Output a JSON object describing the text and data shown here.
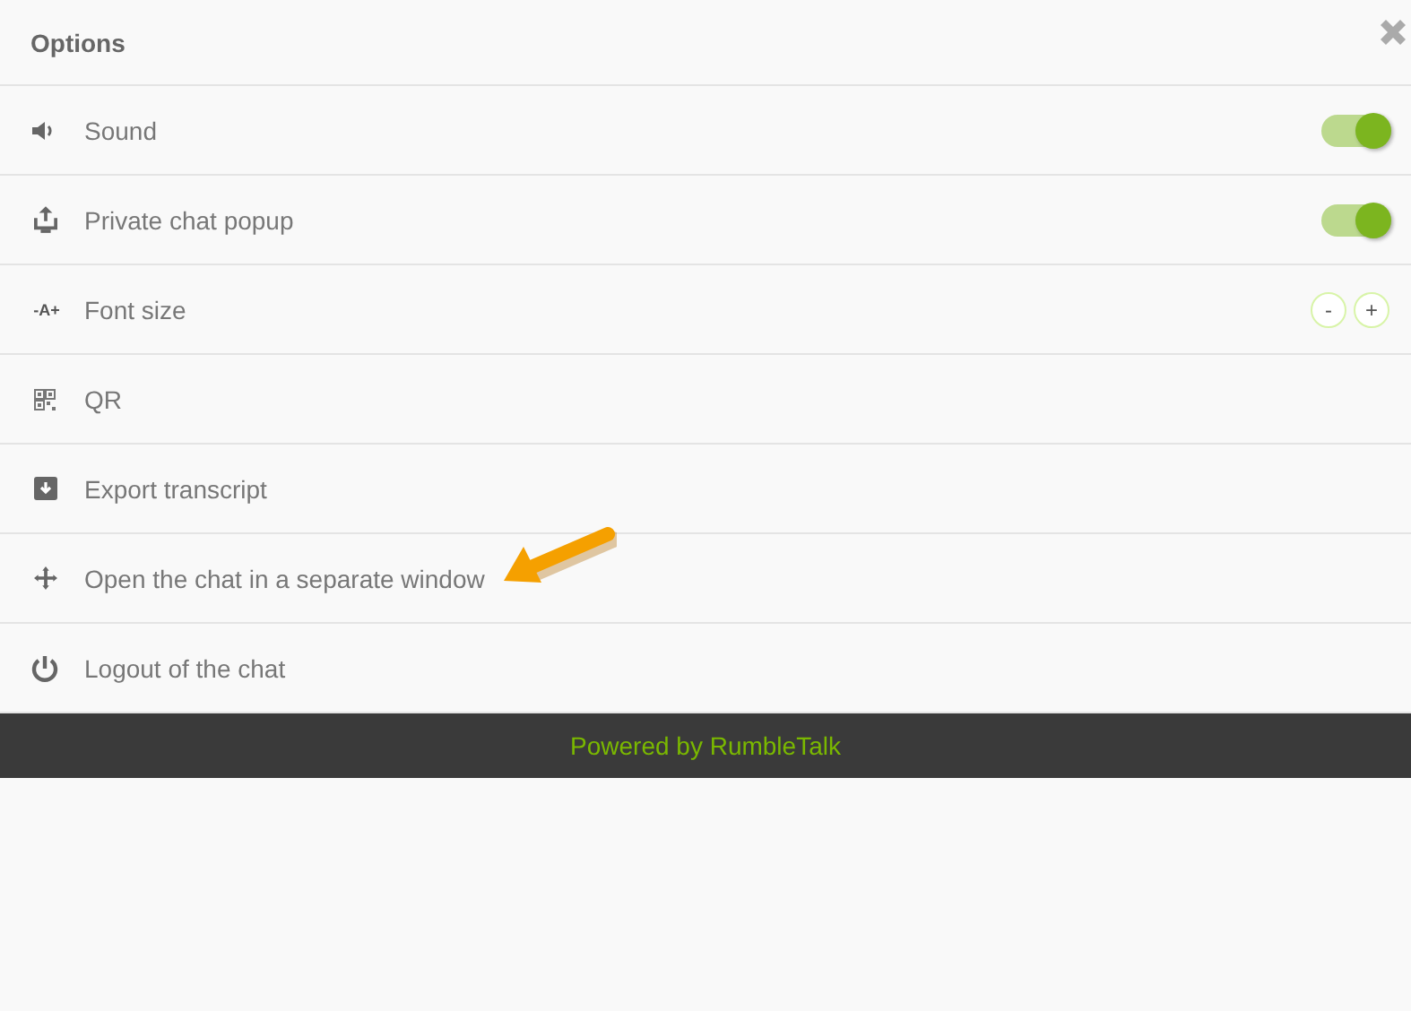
{
  "header": {
    "title": "Options"
  },
  "options": [
    {
      "kind": "toggle",
      "label": "Sound",
      "on": true
    },
    {
      "kind": "toggle",
      "label": "Private chat popup",
      "on": true
    },
    {
      "kind": "stepper",
      "icon_text": "-A+",
      "label": "Font size",
      "buttons": [
        "-",
        "+"
      ]
    },
    {
      "kind": "plain",
      "label": "QR"
    },
    {
      "kind": "plain",
      "label": "Export transcript"
    },
    {
      "kind": "plain",
      "label": "Open the chat in a separate window",
      "pointer": true
    },
    {
      "kind": "plain",
      "label": "Logout of the chat"
    }
  ],
  "footer": {
    "text": "Powered by RumbleTalk"
  }
}
